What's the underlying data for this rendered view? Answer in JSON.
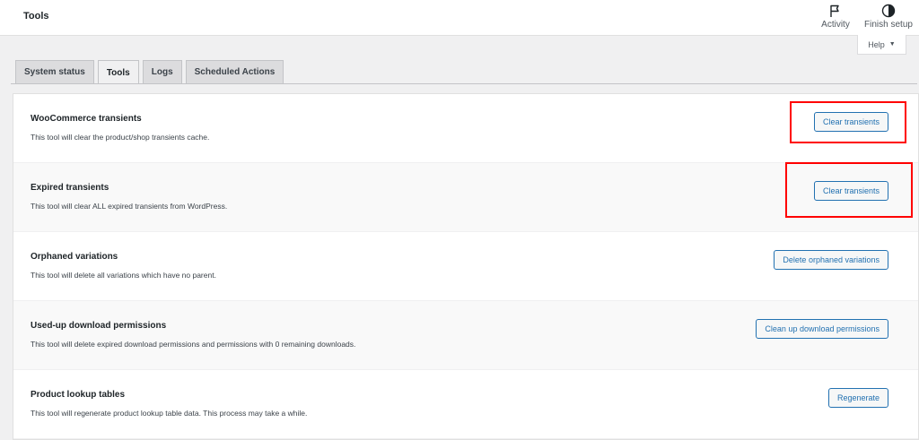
{
  "header": {
    "title": "Tools",
    "actions": [
      {
        "label": "Activity",
        "icon": "flag-icon"
      },
      {
        "label": "Finish setup",
        "icon": "half-circle-icon"
      }
    ]
  },
  "help": {
    "label": "Help",
    "icon": "caret-down-icon"
  },
  "tabs": [
    {
      "label": "System status",
      "active": false
    },
    {
      "label": "Tools",
      "active": true
    },
    {
      "label": "Logs",
      "active": false
    },
    {
      "label": "Scheduled Actions",
      "active": false
    }
  ],
  "tools": [
    {
      "name": "WooCommerce transients",
      "description": "This tool will clear the product/shop transients cache.",
      "button": "Clear transients",
      "highlighted": true
    },
    {
      "name": "Expired transients",
      "description": "This tool will clear ALL expired transients from WordPress.",
      "button": "Clear transients",
      "highlighted": true
    },
    {
      "name": "Orphaned variations",
      "description": "This tool will delete all variations which have no parent.",
      "button": "Delete orphaned variations",
      "highlighted": false
    },
    {
      "name": "Used-up download permissions",
      "description": "This tool will delete expired download permissions and permissions with 0 remaining downloads.",
      "button": "Clean up download permissions",
      "highlighted": false
    },
    {
      "name": "Product lookup tables",
      "description": "This tool will regenerate product lookup table data. This process may take a while.",
      "button": "Regenerate",
      "highlighted": false
    }
  ],
  "colors": {
    "accent": "#2271b1",
    "highlight": "#ff0000",
    "background": "#f0f0f1"
  }
}
